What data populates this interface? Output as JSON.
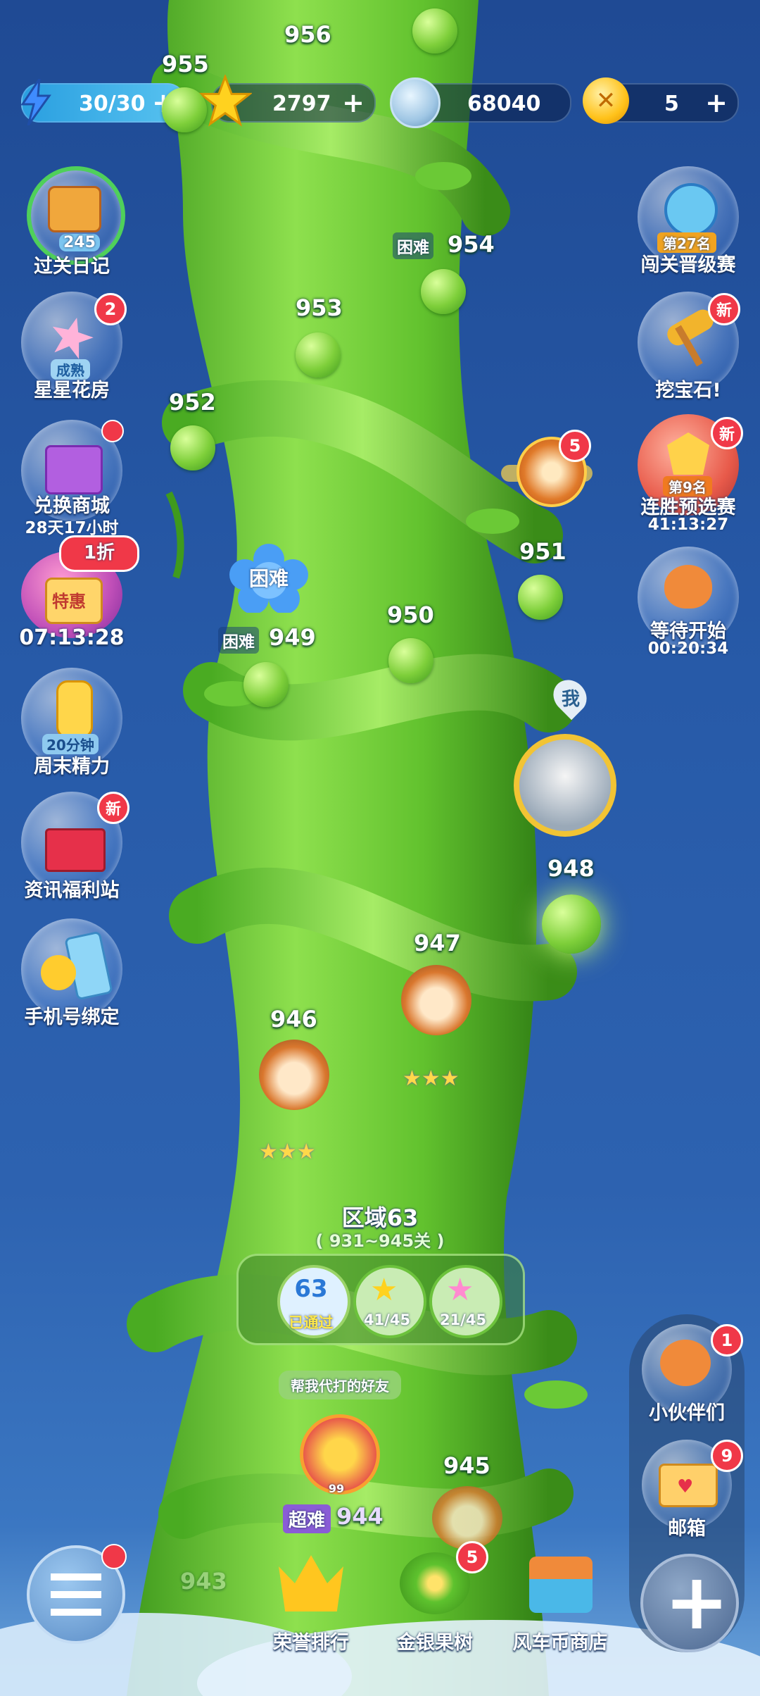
{
  "resources": {
    "energy": {
      "value": "30/30",
      "plus": "+",
      "icon": "lightning-icon"
    },
    "stars": {
      "value": "2797",
      "plus": "+",
      "icon": "star-icon"
    },
    "coins": {
      "value": "68040",
      "icon": "silver-coin-icon"
    },
    "tickets": {
      "value": "5",
      "plus": "+",
      "icon": "gold-x-coin-icon"
    }
  },
  "left_menu": [
    {
      "label": "过关日记",
      "inner": "245",
      "icon": "diary-icon"
    },
    {
      "label": "星星花房",
      "inner": "成熟",
      "badge": "2",
      "icon": "flower-house-icon"
    },
    {
      "label": "兑换商城",
      "sub": "28天17小时",
      "icon": "exchange-shop-icon"
    },
    {
      "label": "07:13:28",
      "inner": "特惠",
      "tag": "1折",
      "icon": "special-offer-icon"
    },
    {
      "label": "周末精力",
      "inner": "20分钟",
      "icon": "energy-bottle-icon"
    },
    {
      "label": "资讯福利站",
      "badge": "新",
      "icon": "gift-box-icon"
    },
    {
      "label": "手机号绑定",
      "icon": "phone-bind-icon"
    }
  ],
  "right_menu": [
    {
      "label": "闯关晋级赛",
      "inner": "第27名",
      "icon": "trophy-badge-icon"
    },
    {
      "label": "挖宝石!",
      "badge": "新",
      "icon": "pickaxe-icon"
    },
    {
      "label": "连胜预选赛",
      "inner": "第9名",
      "sub": "41:13:27",
      "badge": "新",
      "icon": "win-streak-icon"
    },
    {
      "label": "等待开始",
      "sub": "00:20:34",
      "icon": "fox-icon"
    }
  ],
  "levels": [
    {
      "n": "956"
    },
    {
      "n": "955"
    },
    {
      "n": "954",
      "tag": "困难"
    },
    {
      "n": "953"
    },
    {
      "n": "952"
    },
    {
      "n": "951"
    },
    {
      "n": "950"
    },
    {
      "n": "949",
      "tag": "困难"
    },
    {
      "n": "948"
    },
    {
      "n": "947"
    },
    {
      "n": "946"
    },
    {
      "n": "945"
    },
    {
      "n": "944",
      "tag": "超难"
    },
    {
      "n": "943"
    }
  ],
  "flower_tag": "困难",
  "wheel_badge": "5",
  "me_label": "我",
  "friend_help": "帮我代打的好友",
  "friend_level": "99",
  "region": {
    "title": "区域63",
    "range": "( 931~945关 )",
    "region_num": "63",
    "passed": "已通过",
    "stars": "41/45",
    "rainbow": "21/45"
  },
  "side_right": [
    {
      "label": "小伙伴们",
      "badge": "1",
      "icon": "partners-icon"
    },
    {
      "label": "邮箱",
      "badge": "9",
      "icon": "mail-icon"
    }
  ],
  "bottom": [
    {
      "label": "荣誉排行",
      "icon": "crown-icon"
    },
    {
      "label": "金银果树",
      "badge": "5",
      "icon": "fruit-tree-icon"
    },
    {
      "label": "风车币商店",
      "icon": "windmill-shop-icon"
    }
  ],
  "colors": {
    "accent": "#5fd43a",
    "badge": "#f03848",
    "bg": "#275aa8"
  }
}
